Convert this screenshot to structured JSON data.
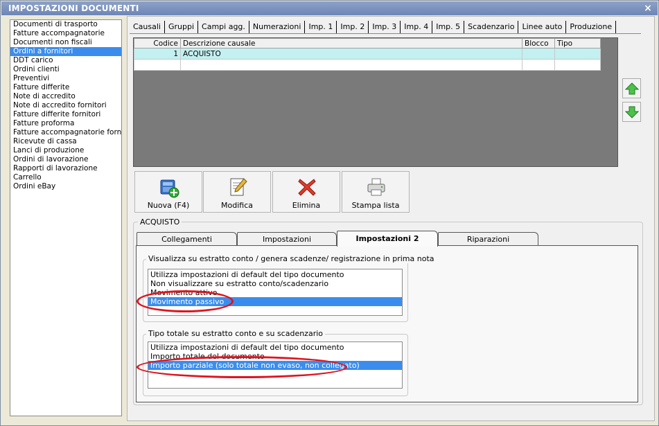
{
  "window": {
    "title": "IMPOSTAZIONI DOCUMENTI",
    "close": "×"
  },
  "doc_types": [
    {
      "label": "Documenti di trasporto",
      "selected": false
    },
    {
      "label": "Fatture accompagnatorie",
      "selected": false
    },
    {
      "label": "Documenti non fiscali",
      "selected": false
    },
    {
      "label": "Ordini a fornitori",
      "selected": true
    },
    {
      "label": "DDT carico",
      "selected": false
    },
    {
      "label": "Ordini clienti",
      "selected": false
    },
    {
      "label": "Preventivi",
      "selected": false
    },
    {
      "label": "Fatture differite",
      "selected": false
    },
    {
      "label": "Note di accredito",
      "selected": false
    },
    {
      "label": "Note di accredito fornitori",
      "selected": false
    },
    {
      "label": "Fatture differite fornitori",
      "selected": false
    },
    {
      "label": "Fatture proforma",
      "selected": false
    },
    {
      "label": "Fatture accompagnatorie fornito",
      "selected": false
    },
    {
      "label": "Ricevute di cassa",
      "selected": false
    },
    {
      "label": "Lanci di produzione",
      "selected": false
    },
    {
      "label": "Ordini di lavorazione",
      "selected": false
    },
    {
      "label": "Rapporti di lavorazione",
      "selected": false
    },
    {
      "label": "Carrello",
      "selected": false
    },
    {
      "label": "Ordini eBay",
      "selected": false
    }
  ],
  "tabs": [
    "Causali",
    "Gruppi",
    "Campi agg.",
    "Numerazioni",
    "Imp. 1",
    "Imp. 2",
    "Imp. 3",
    "Imp. 4",
    "Imp. 5",
    "Scadenzario",
    "Linee auto",
    "Produzione"
  ],
  "grid": {
    "columns": [
      "Codice",
      "Descrizione causale",
      "Blocco",
      "Tipo"
    ],
    "rows": [
      {
        "codice": "1",
        "descrizione": "ACQUISTO",
        "blocco": "",
        "tipo": ""
      },
      {
        "codice": "",
        "descrizione": "",
        "blocco": "",
        "tipo": ""
      }
    ]
  },
  "toolbar": {
    "new": "Nuova (F4)",
    "edit": "Modifica",
    "delete": "Elimina",
    "print": "Stampa lista"
  },
  "group_title": "ACQUISTO",
  "subtabs": [
    {
      "label": "Collegamenti",
      "active": false
    },
    {
      "label": "Impostazioni",
      "active": false
    },
    {
      "label": "Impostazioni 2",
      "active": true
    },
    {
      "label": "Riparazioni",
      "active": false
    }
  ],
  "section1": {
    "title": "Visualizza su estratto conto / genera scadenze/ registrazione  in prima nota",
    "options": [
      {
        "label": "Utilizza impostazioni di default del tipo documento",
        "selected": false
      },
      {
        "label": "Non visualizzare su estratto conto/scadenzario",
        "selected": false
      },
      {
        "label": "Movimento attivo",
        "selected": false
      },
      {
        "label": "Movimento passivo",
        "selected": true
      }
    ]
  },
  "section2": {
    "title": "Tipo totale su estratto conto e su scadenzario",
    "options": [
      {
        "label": "Utilizza impostazioni di default del tipo documento",
        "selected": false
      },
      {
        "label": "Importo totale del documento",
        "selected": false
      },
      {
        "label": "Importo parziale (solo totale non evaso, non collegato)",
        "selected": true
      }
    ]
  },
  "colors": {
    "selection": "#3b8ded",
    "highlight_row": "#c3f0f0",
    "annotation": "#e0141e",
    "titlebar": "#7a90be"
  },
  "icons": [
    "up-arrow-icon",
    "down-arrow-icon",
    "new-document-icon",
    "edit-document-icon",
    "delete-x-icon",
    "printer-icon"
  ]
}
